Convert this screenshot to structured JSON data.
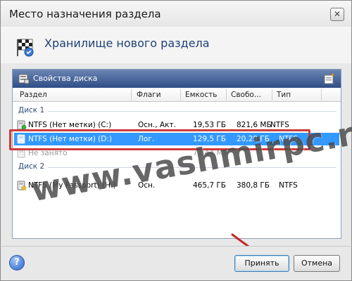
{
  "window": {
    "title": "Место назначения раздела",
    "close_label": "✕"
  },
  "header": {
    "title": "Хранилище нового раздела"
  },
  "panel": {
    "title": "Свойства диска",
    "columns": [
      "Раздел",
      "Флаги",
      "Емкость",
      "Свобо...",
      "Тип"
    ]
  },
  "disks": [
    {
      "label": "Диск 1",
      "rows": [
        {
          "name": "NTFS (Нет метки) (C:)",
          "flags": "Осн., Акт.",
          "capacity": "19,53 ГБ",
          "free": "821,6 МБ",
          "type": "NTFS"
        },
        {
          "name": "NTFS (Нет метки) (D:)",
          "flags": "Лог.",
          "capacity": "129,5 ГБ",
          "free": "20,29 ГБ",
          "type": "NTFS"
        },
        {
          "name": "Не занято",
          "flags": "",
          "capacity": "7,844 МБ",
          "free": "",
          "type": ""
        }
      ]
    },
    {
      "label": "Диск 2",
      "rows": [
        {
          "name": "NTFS (My Passport) (H:)",
          "flags": "Осн.",
          "capacity": "465,7 ГБ",
          "free": "380,8 ГБ",
          "type": "NTFS"
        }
      ]
    }
  ],
  "watermark": "www.vashmirpc.ru",
  "footer": {
    "help_label": "?",
    "accept_label": "Принять",
    "cancel_label": "Отмена"
  },
  "colors": {
    "selection": "#3399ff",
    "highlight_box": "#cf3a3a",
    "panel_header": "#2f4d86",
    "arrow": "#c62828"
  }
}
